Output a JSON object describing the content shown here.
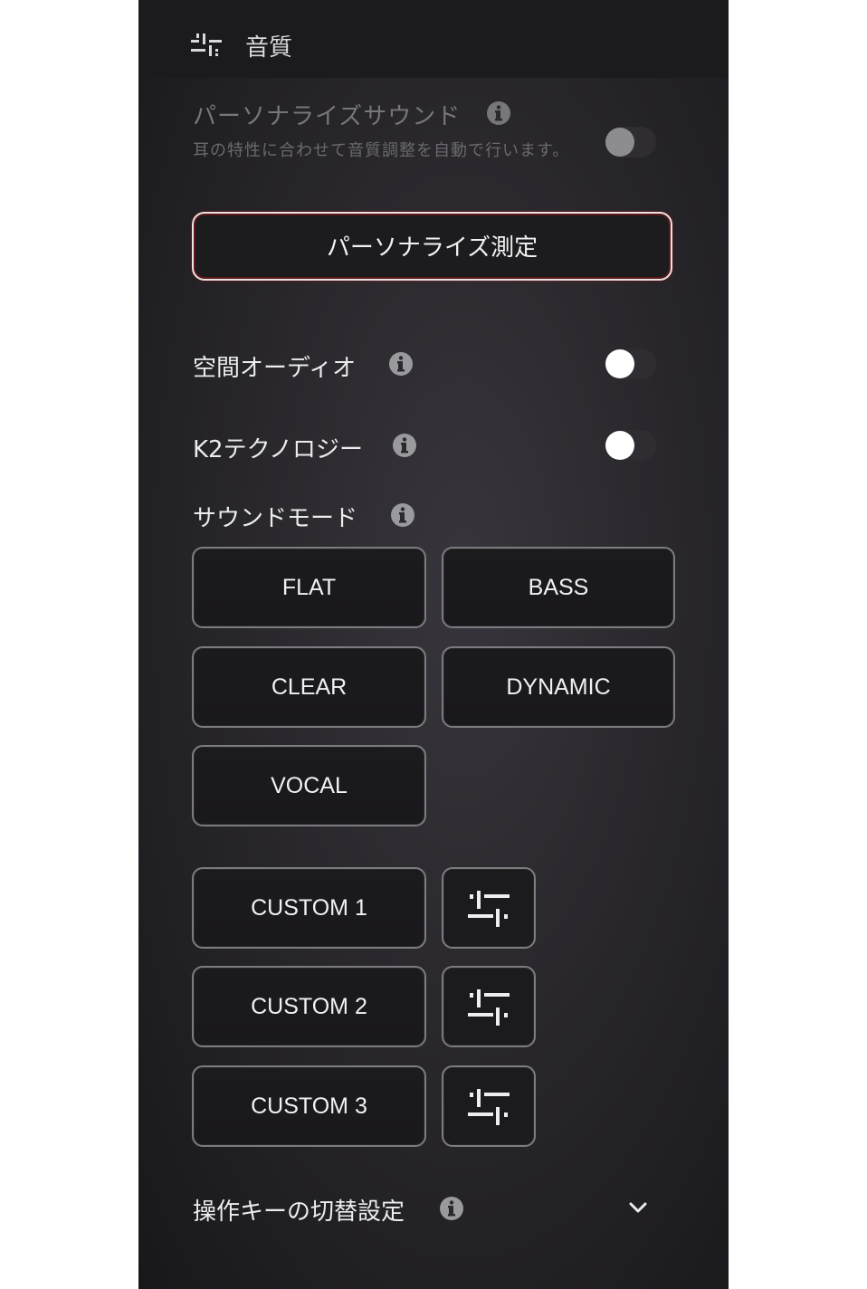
{
  "header": {
    "title": "音質",
    "icon": "sliders-icon"
  },
  "personalize": {
    "title": "パーソナライズサウンド",
    "description": "耳の特性に合わせて音質調整を自動で行います。",
    "enabled": false,
    "measure_button": "パーソナライズ測定"
  },
  "spatial_audio": {
    "label": "空間オーディオ",
    "enabled": false
  },
  "k2": {
    "label": "K2テクノロジー",
    "enabled": false
  },
  "sound_mode": {
    "label": "サウンドモード",
    "presets": [
      "FLAT",
      "BASS",
      "CLEAR",
      "DYNAMIC",
      "VOCAL"
    ],
    "customs": [
      "CUSTOM 1",
      "CUSTOM 2",
      "CUSTOM 3"
    ]
  },
  "key_switch": {
    "label": "操作キーの切替設定",
    "icon": "chevron-down-icon"
  },
  "colors": {
    "panel_bg": "#2b292e",
    "accent_glow": "#961414",
    "text": "#ececee"
  }
}
